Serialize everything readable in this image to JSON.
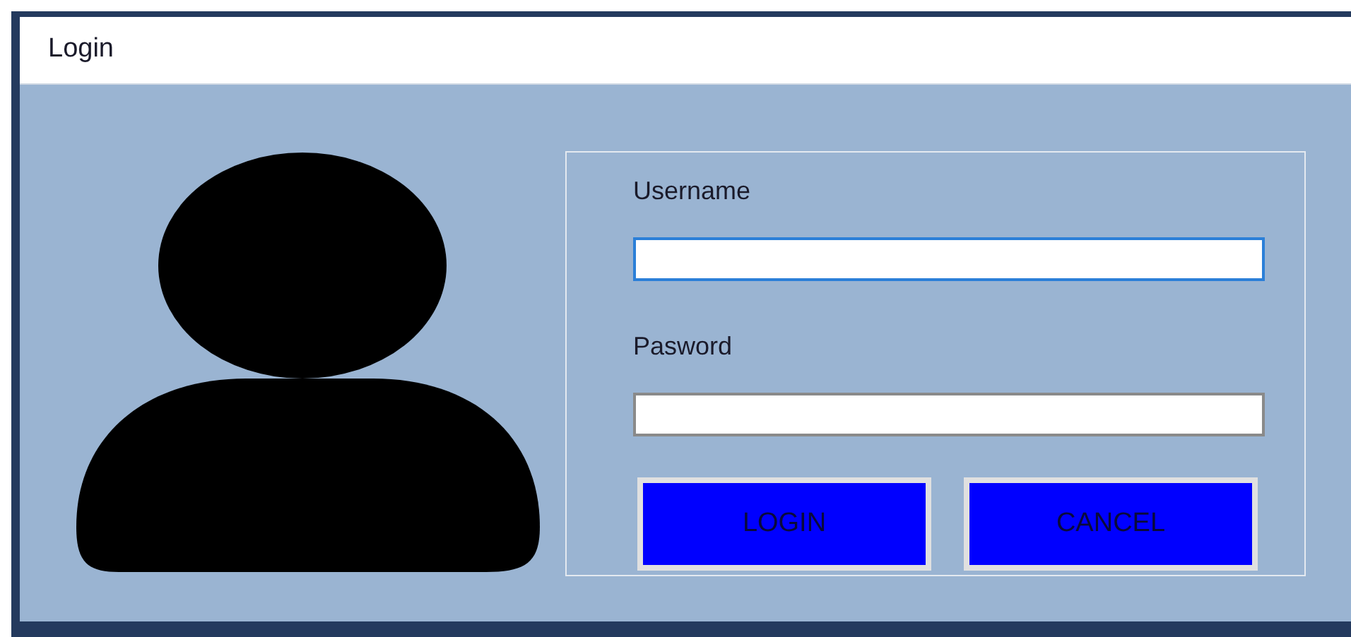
{
  "window": {
    "title": "Login"
  },
  "fields": [
    {
      "label": "Username",
      "focused": true
    },
    {
      "label": "Pasword",
      "focused": false
    }
  ],
  "buttons": [
    "LOGIN",
    "CANCEL"
  ]
}
